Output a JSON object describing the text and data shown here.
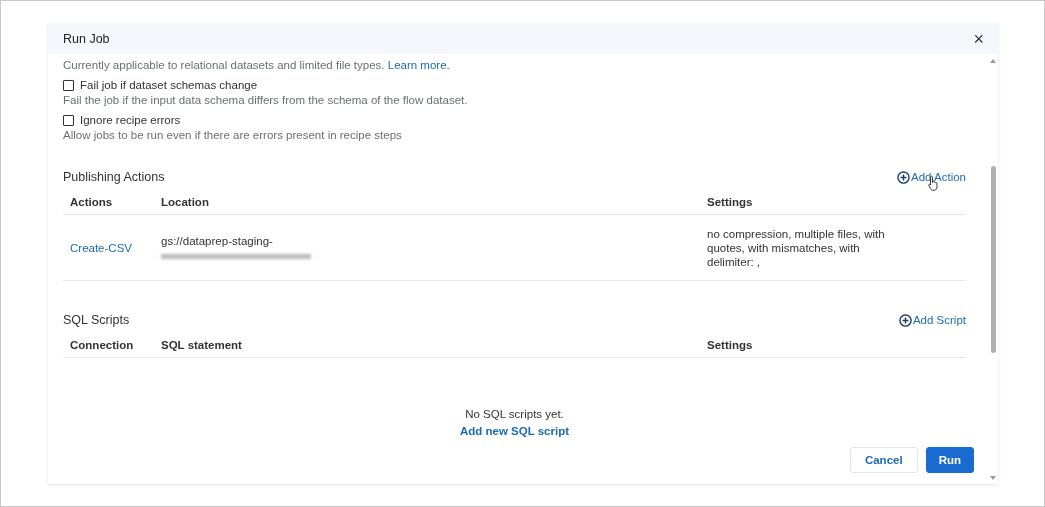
{
  "dialog": {
    "title": "Run Job",
    "close": "×"
  },
  "note": {
    "text": "Currently applicable to relational datasets and limited file types.",
    "link": "Learn more."
  },
  "options": [
    {
      "label": "Fail job if dataset schemas change",
      "checked": false,
      "description": "Fail the job if the input data schema differs from the schema of the flow dataset."
    },
    {
      "label": "Ignore recipe errors",
      "checked": false,
      "description": "Allow jobs to be run even if there are errors present in recipe steps"
    }
  ],
  "publishing": {
    "title": "Publishing Actions",
    "add": "Add Action",
    "columns": [
      "Actions",
      "Location",
      "Settings"
    ],
    "rows": [
      {
        "action": "Create-CSV",
        "location": "gs://dataprep-staging-",
        "settings": "no compression, multiple files, with quotes, with mismatches, with delimiter: ,"
      }
    ]
  },
  "sql": {
    "title": "SQL Scripts",
    "add": "Add Script",
    "columns": [
      "Connection",
      "SQL statement",
      "Settings"
    ],
    "empty": "No SQL scripts yet.",
    "empty_link": "Add new SQL script"
  },
  "buttons": [
    {
      "label": "Cancel",
      "kind": "secondary"
    },
    {
      "label": "Run",
      "kind": "primary"
    }
  ]
}
